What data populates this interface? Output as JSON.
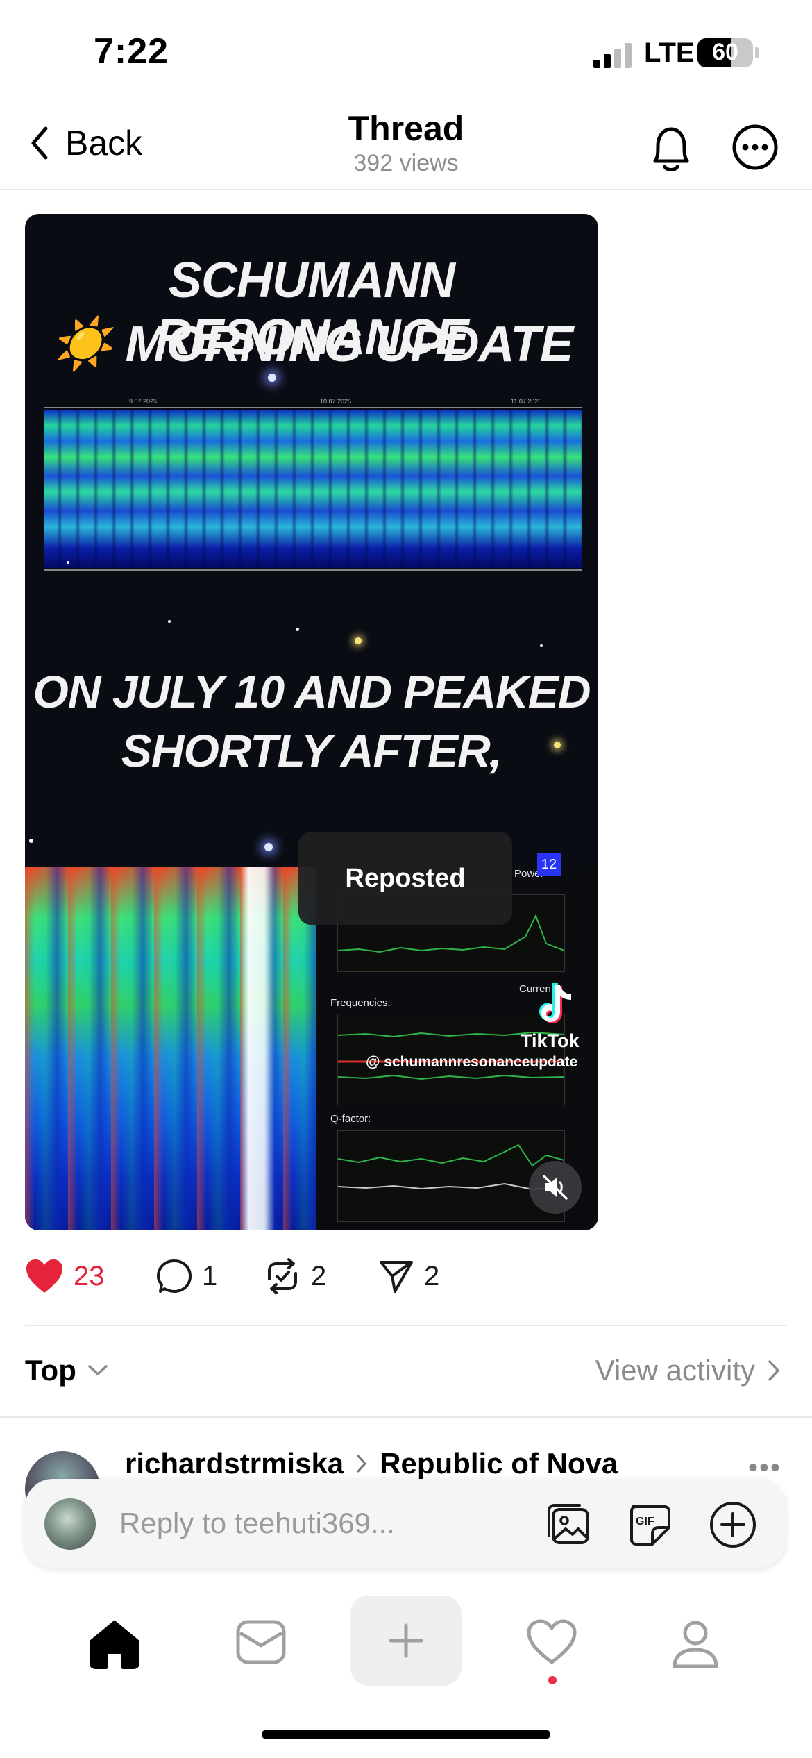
{
  "status_bar": {
    "time": "7:22",
    "network": "LTE",
    "battery": "60"
  },
  "nav": {
    "back_label": "Back",
    "title": "Thread",
    "subtitle": "392 views"
  },
  "video": {
    "title_line1": "SCHUMANN RESONANCE",
    "title_sun": "☀️",
    "title_line2": "MORNING UPDATE",
    "caption_line1": "ON JULY 10 AND PEAKED",
    "caption_line2": "SHORTLY AFTER,",
    "date_labels": [
      "9.07.2025",
      "10.07.2025",
      "11.07.2025"
    ],
    "panel_power_label": "Power",
    "panel_power_badge": "12",
    "panel_current_label": "Current:",
    "panel_frequencies_label": "Frequencies:",
    "panel_qfactor_label": "Q-factor:",
    "toast": "Reposted",
    "tiktok_brand": "TikTok",
    "tiktok_handle": "@ schumannresonanceupdate",
    "muted": true
  },
  "actions": {
    "likes": "23",
    "comments": "1",
    "reposts": "2",
    "shares": "2",
    "liked": true
  },
  "sort": {
    "label": "Top",
    "view_activity": "View activity"
  },
  "reply_peek": {
    "username": "richardstrmiska",
    "community": "Republic of Nova"
  },
  "reply_bar": {
    "placeholder": "Reply to teehuti369..."
  },
  "colors": {
    "like_red": "#e5243b",
    "notif_dot": "#ea2e4b",
    "muted_text": "#8e8e8e"
  },
  "tabbar": {
    "items": [
      "home-icon",
      "inbox-icon",
      "create-icon",
      "activity-icon",
      "profile-icon"
    ],
    "active": "home-icon"
  }
}
